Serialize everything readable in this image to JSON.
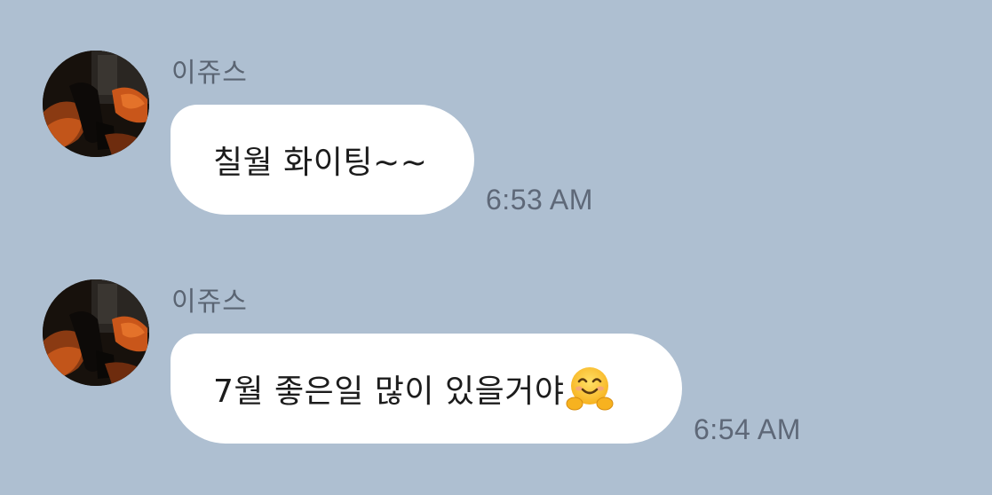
{
  "messages": [
    {
      "sender": "이쥬스",
      "text": "칠월 화이팅~~",
      "time": "6:53 AM",
      "avatar_icon": "profile-photo-icon"
    },
    {
      "sender": "이쥬스",
      "text": "7월 좋은일 많이 있을거야",
      "emoji": "smiling-face-with-open-hands-icon",
      "time": "6:54 AM",
      "avatar_icon": "profile-photo-icon"
    }
  ],
  "colors": {
    "background": "#aebfd1",
    "bubble": "#ffffff",
    "sender_text": "#5a6472",
    "time_text": "#5e6878"
  }
}
